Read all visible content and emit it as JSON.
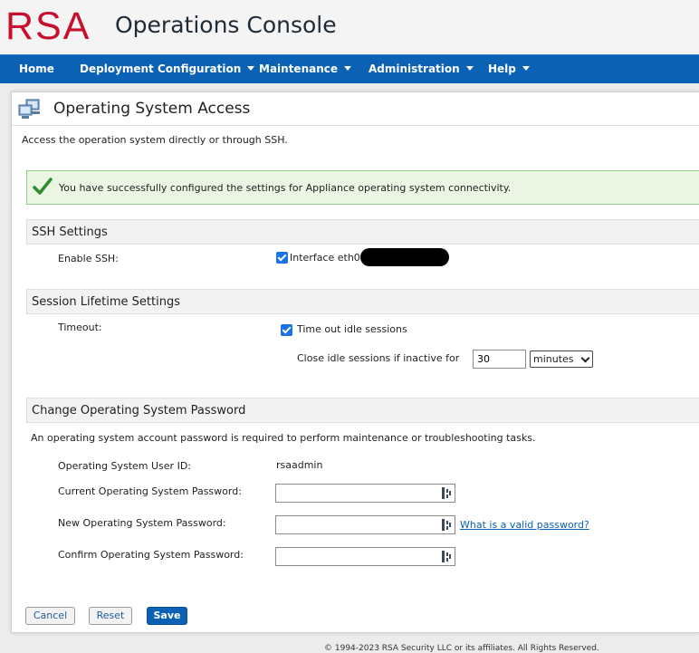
{
  "header": {
    "logo": "RSA",
    "title": "Operations Console"
  },
  "nav": {
    "home": "Home",
    "deployment": "Deployment Configuration",
    "maintenance": "Maintenance",
    "administration": "Administration",
    "help": "Help"
  },
  "page": {
    "title": "Operating System Access",
    "description": "Access the operation system directly or through SSH.",
    "success_message": "You have successfully configured the settings for Appliance operating system connectivity."
  },
  "ssh": {
    "section_title": "SSH Settings",
    "enable_label": "Enable SSH:",
    "interface_label": "Interface eth0",
    "interface_checked": true
  },
  "session": {
    "section_title": "Session Lifetime Settings",
    "timeout_label": "Timeout:",
    "idle_checkbox_label": "Time out idle sessions",
    "idle_checked": true,
    "inactive_label": "Close idle sessions if inactive for",
    "inactive_value": "30",
    "unit_selected": "minutes"
  },
  "password": {
    "section_title": "Change Operating System Password",
    "description": "An operating system account password is required to perform maintenance or troubleshooting tasks.",
    "user_id_label": "Operating System User ID:",
    "user_id_value": "rsaadmin",
    "current_label": "Current Operating System Password:",
    "new_label": "New Operating System Password:",
    "confirm_label": "Confirm Operating System Password:",
    "valid_link": "What is a valid password?"
  },
  "buttons": {
    "cancel": "Cancel",
    "reset": "Reset",
    "save": "Save"
  },
  "footer": {
    "copyright": "© 1994-2023 RSA Security LLC or its affiliates. All Rights Reserved."
  },
  "colors": {
    "brand_red": "#c8102e",
    "nav_blue": "#0b61b4",
    "success_bg": "#eaf6e3",
    "checkbox_blue": "#1a73e8"
  },
  "icons": {
    "title": "network-computers-icon",
    "success": "checkmark-icon",
    "password_manager": "password-manager-icon",
    "dropdown": "caret-down-icon"
  }
}
